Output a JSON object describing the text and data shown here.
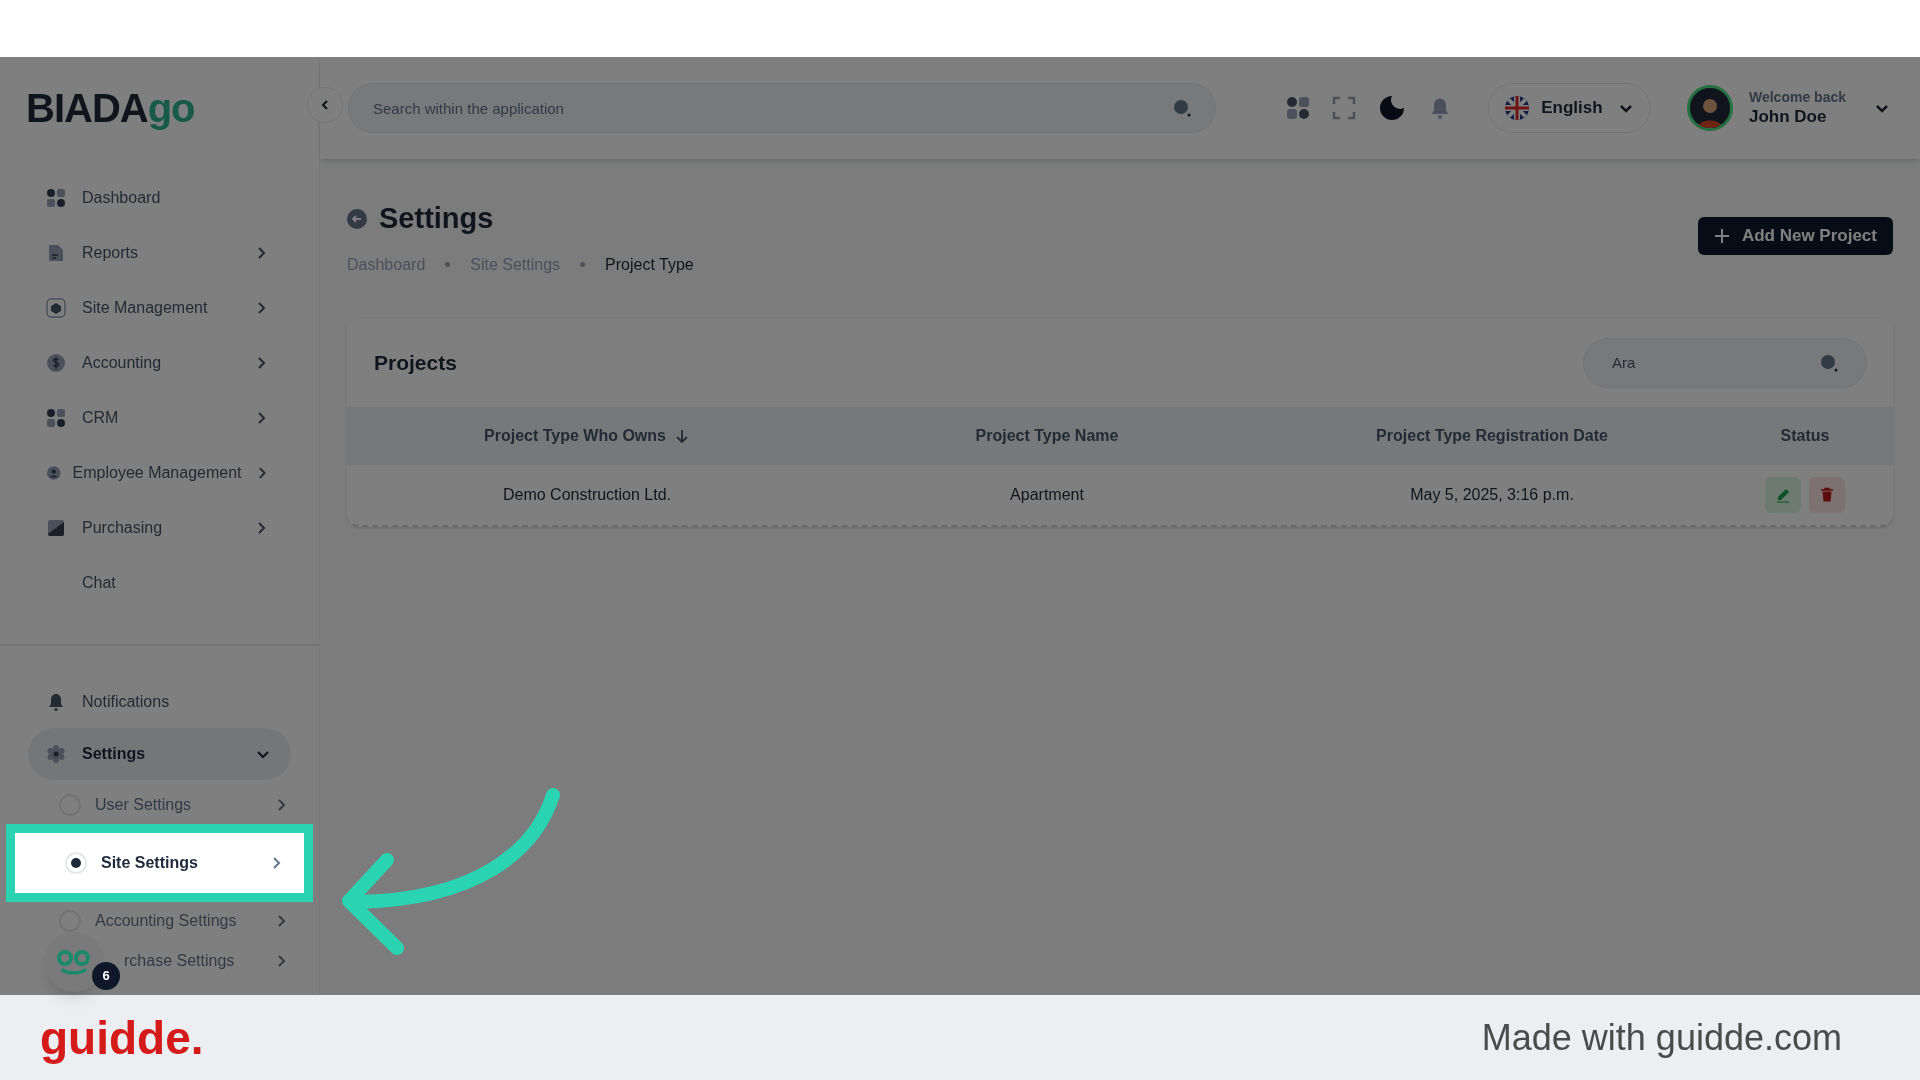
{
  "logo": {
    "text": "BIADA",
    "accent": "go"
  },
  "sidebar": {
    "items": [
      {
        "label": "Dashboard",
        "expandable": false,
        "kind": "grid"
      },
      {
        "label": "Reports",
        "expandable": true,
        "kind": "doc"
      },
      {
        "label": "Site Management",
        "expandable": true,
        "kind": "box"
      },
      {
        "label": "Accounting",
        "expandable": true,
        "kind": "dollar"
      },
      {
        "label": "CRM",
        "expandable": true,
        "kind": "grid"
      },
      {
        "label": "Employee Management",
        "expandable": true,
        "kind": "person"
      },
      {
        "label": "Purchasing",
        "expandable": true,
        "kind": "tag"
      },
      {
        "label": "Chat",
        "expandable": false,
        "kind": "none"
      }
    ],
    "bottom": [
      {
        "label": "Notifications",
        "kind": "bell",
        "expanded": false
      },
      {
        "label": "Settings",
        "kind": "gear",
        "expanded": true,
        "children": [
          {
            "label": "User Settings",
            "selected": false
          },
          {
            "label": "Site Settings",
            "selected": true
          },
          {
            "label": "Accounting Settings",
            "selected": false
          },
          {
            "label": "rchase Settings",
            "selected": false
          }
        ]
      }
    ]
  },
  "header": {
    "search_placeholder": "Search within the application",
    "language": "English",
    "welcome": "Welcome back",
    "user": "John Doe"
  },
  "page": {
    "title": "Settings",
    "breadcrumbs": [
      {
        "label": "Dashboard",
        "selected": false
      },
      {
        "label": "Site Settings",
        "selected": false
      },
      {
        "label": "Project Type",
        "selected": true
      }
    ],
    "add_button": "Add New Project"
  },
  "card": {
    "title": "Projects",
    "search_value": "Ara",
    "columns": [
      {
        "label": "Project Type Who Owns",
        "sorted": true
      },
      {
        "label": "Project Type Name",
        "sorted": false
      },
      {
        "label": "Project Type Registration Date",
        "sorted": false
      },
      {
        "label": "Status",
        "sorted": false
      }
    ],
    "rows": [
      {
        "cells": [
          "Demo Construction Ltd.",
          "Apartment",
          "May 5, 2025, 3:16 p.m."
        ]
      }
    ]
  },
  "chat_badge": "6",
  "footer": {
    "brand": "guidde.",
    "tagline": "Made with guidde.com"
  }
}
